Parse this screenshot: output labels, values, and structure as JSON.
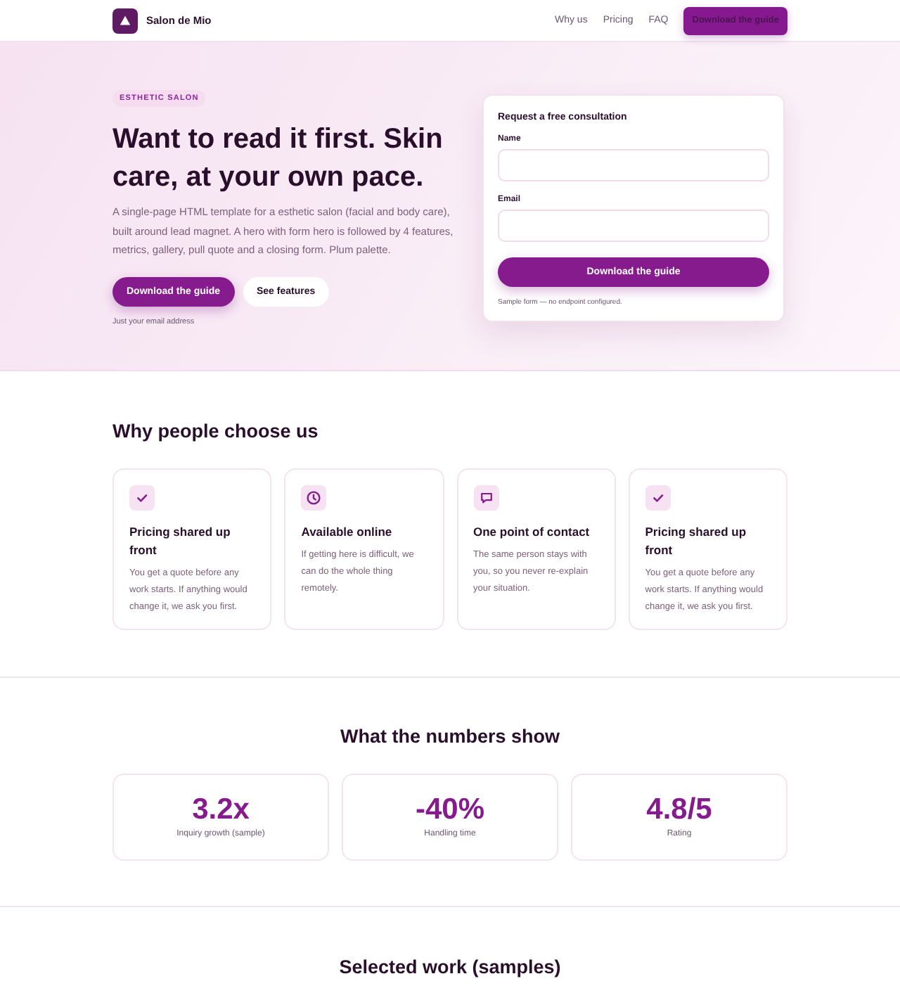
{
  "nav": {
    "brand": "Salon de Mio",
    "links": [
      "Why us",
      "Pricing",
      "FAQ"
    ],
    "cta": "Download the guide"
  },
  "hero": {
    "eyebrow": "ESTHETIC SALON",
    "title": "Want to read it first. Skin care, at your own pace.",
    "description": "A single-page HTML template for a esthetic salon (facial and body care), built around lead magnet. A hero with form hero is followed by 4 features, metrics, gallery, pull quote and a closing form. Plum palette.",
    "buttons": [
      {
        "label": "Download the guide",
        "kind": "primary"
      },
      {
        "label": "See features",
        "kind": "secondary"
      }
    ],
    "note": "Just your email address"
  },
  "form": {
    "title": "Request a free consultation",
    "fields": [
      {
        "label": "Name"
      },
      {
        "label": "Email"
      }
    ],
    "submit": "Download the guide",
    "note": "Sample form — no endpoint configured."
  },
  "features": {
    "heading": "Why people choose us",
    "items": [
      {
        "kind": "check",
        "title": "Pricing shared up front",
        "text": "You get a quote before any work starts. If anything would change it, we ask you first."
      },
      {
        "kind": "clock",
        "title": "Available online",
        "text": "If getting here is difficult, we can do the whole thing remotely."
      },
      {
        "kind": "message",
        "title": "One point of contact",
        "text": "The same person stays with you, so you never re-explain your situation."
      },
      {
        "kind": "check",
        "title": "Pricing shared up front",
        "text": "You get a quote before any work starts. If anything would change it, we ask you first."
      }
    ]
  },
  "metrics": {
    "heading": "What the numbers show",
    "items": [
      {
        "value": "3.2x",
        "label": "Inquiry growth (sample)"
      },
      {
        "value": "-40%",
        "label": "Handling time"
      },
      {
        "value": "4.8/5",
        "label": "Rating"
      }
    ]
  },
  "gallery": {
    "heading": "Selected work (samples)"
  }
}
